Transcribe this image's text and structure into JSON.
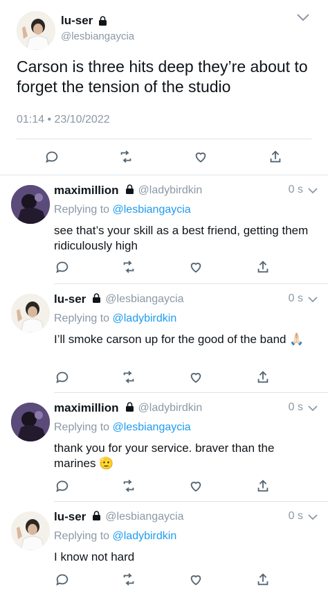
{
  "main_tweet": {
    "name": "lu-ser",
    "handle": "@lesbiangaycia",
    "text": "Carson is three hits deep they’re about to forget the tension of the studio",
    "timestamp": "01:14 • 23/10/2022"
  },
  "replies": [
    {
      "name": "maximillion",
      "handle": "@ladybirdkin",
      "time": "0 s",
      "replying_prefix": "Replying to ",
      "replying_to": "@lesbiangaycia",
      "text": "see that’s your skill as a best friend, getting them ridiculously high",
      "emoji": ""
    },
    {
      "name": "lu-ser",
      "handle": "@lesbiangaycia",
      "time": "0 s",
      "replying_prefix": "Replying to ",
      "replying_to": "@ladybirdkin",
      "text": "I’ll smoke carson up for the good of the band",
      "emoji": "🙏🏻"
    },
    {
      "name": "maximillion",
      "handle": "@ladybirdkin",
      "time": "0 s",
      "replying_prefix": "Replying to ",
      "replying_to": "@lesbiangaycia",
      "text": "thank you for your service. braver than the marines",
      "emoji": "🫡"
    },
    {
      "name": "lu-ser",
      "handle": "@lesbiangaycia",
      "time": "0 s",
      "replying_prefix": "Replying to ",
      "replying_to": "@ladybirdkin",
      "text": "I know not hard",
      "emoji": ""
    }
  ],
  "icons": {
    "reply": "reply-icon",
    "retweet": "retweet-icon",
    "like": "like-icon",
    "share": "share-icon",
    "lock": "lock-icon",
    "more": "chevron-down-icon"
  },
  "colors": {
    "link": "#1d9bf0",
    "muted": "#8b98a5",
    "divider": "#dfe3e6"
  }
}
